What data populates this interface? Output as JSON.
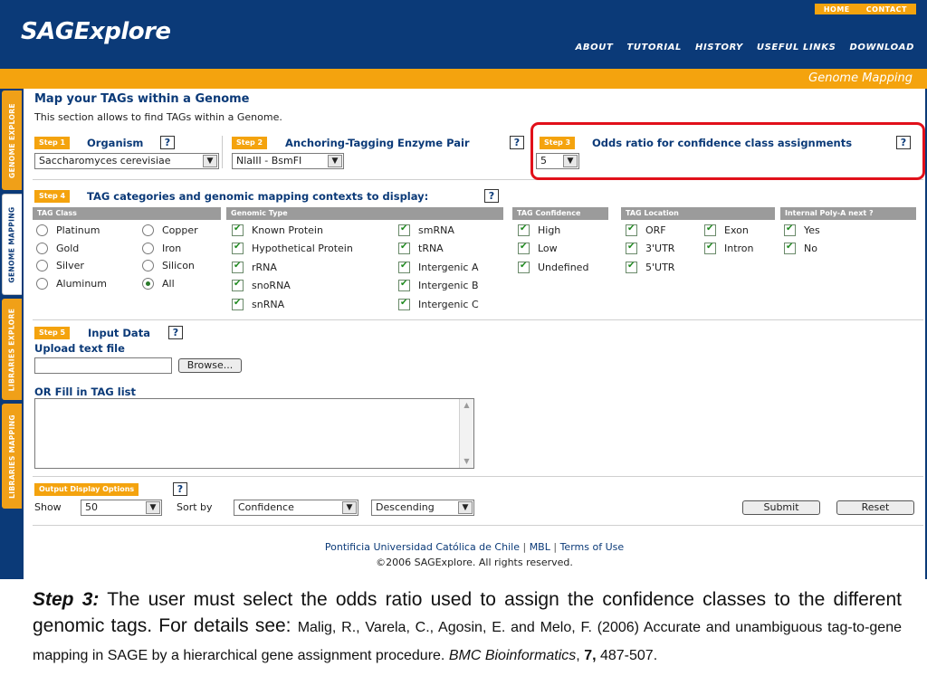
{
  "header": {
    "logo": "SAGExplore",
    "top_links": [
      "HOME",
      "CONTACT"
    ],
    "nav": [
      "ABOUT",
      "TUTORIAL",
      "HISTORY",
      "USEFUL LINKS",
      "DOWNLOAD"
    ]
  },
  "titlebar": "Genome Mapping",
  "side_tabs": [
    "GENOME EXPLORE",
    "GENOME MAPPING",
    "LIBRARIES EXPLORE",
    "LIBRARIES MAPPING"
  ],
  "page": {
    "title": "Map your TAGs within a Genome",
    "subtitle": "This section allows to find TAGs within a Genome."
  },
  "step1": {
    "badge": "Step 1",
    "title": "Organism",
    "help": "?",
    "value": "Saccharomyces cerevisiae"
  },
  "step2": {
    "badge": "Step 2",
    "title": "Anchoring-Tagging Enzyme Pair",
    "help": "?",
    "value": "NlaIII - BsmFI"
  },
  "step3": {
    "badge": "Step 3",
    "title": "Odds ratio for confidence class assignments",
    "help": "?",
    "value": "5"
  },
  "step4": {
    "badge": "Step 4",
    "title": "TAG categories and genomic mapping contexts to display:",
    "help": "?",
    "headers": {
      "tag_class": "TAG Class",
      "genomic_type": "Genomic Type",
      "tag_confidence": "TAG Confidence",
      "tag_location": "TAG Location",
      "polya": "Internal Poly-A next ?"
    },
    "tag_class": [
      "Platinum",
      "Copper",
      "Gold",
      "Iron",
      "Silver",
      "Silicon",
      "Aluminum",
      "All"
    ],
    "genomic_type": [
      "Known Protein",
      "smRNA",
      "Hypothetical Protein",
      "tRNA",
      "rRNA",
      "Intergenic A",
      "snoRNA",
      "Intergenic B",
      "snRNA",
      "Intergenic C"
    ],
    "tag_confidence": [
      "High",
      "Low",
      "Undefined"
    ],
    "tag_location": [
      "ORF",
      "Exon",
      "3'UTR",
      "Intron",
      "5'UTR"
    ],
    "polya": [
      "Yes",
      "No"
    ]
  },
  "step5": {
    "badge": "Step 5",
    "title": "Input Data",
    "help": "?",
    "upload_label": "Upload text file",
    "browse_label": "Browse...",
    "fill_label": "OR Fill in TAG list"
  },
  "output": {
    "badge": "Output Display Options",
    "help": "?",
    "show_label": "Show",
    "show_value": "50",
    "sort_label": "Sort by",
    "sort_value": "Confidence",
    "order_value": "Descending",
    "submit_label": "Submit",
    "reset_label": "Reset"
  },
  "footer": {
    "links": [
      "Pontificia Universidad Católica de Chile",
      "|",
      "MBL",
      "|",
      "Terms of Use"
    ],
    "copyright": "©2006 SAGExplore. All rights reserved."
  },
  "caption": {
    "step_label": "Step 3:",
    "text1": " The user must select the odds ratio used to assign the confidence classes to the different genomic tags. For details see: ",
    "ref_authors": "Malig, R., Varela, C., Agosin, E. and Melo, F. (2006) Accurate and unambiguous tag-to-gene mapping in SAGE by a hierarchical gene assignment procedure. ",
    "journal": "BMC Bioinformatics",
    "comma": ", ",
    "volume": "7,",
    "pages": " 487-507."
  },
  "colors": {
    "navy": "#0b3a78",
    "orange": "#f4a30e",
    "highlight": "#e1101a",
    "grey_header": "#9b9b9b"
  }
}
